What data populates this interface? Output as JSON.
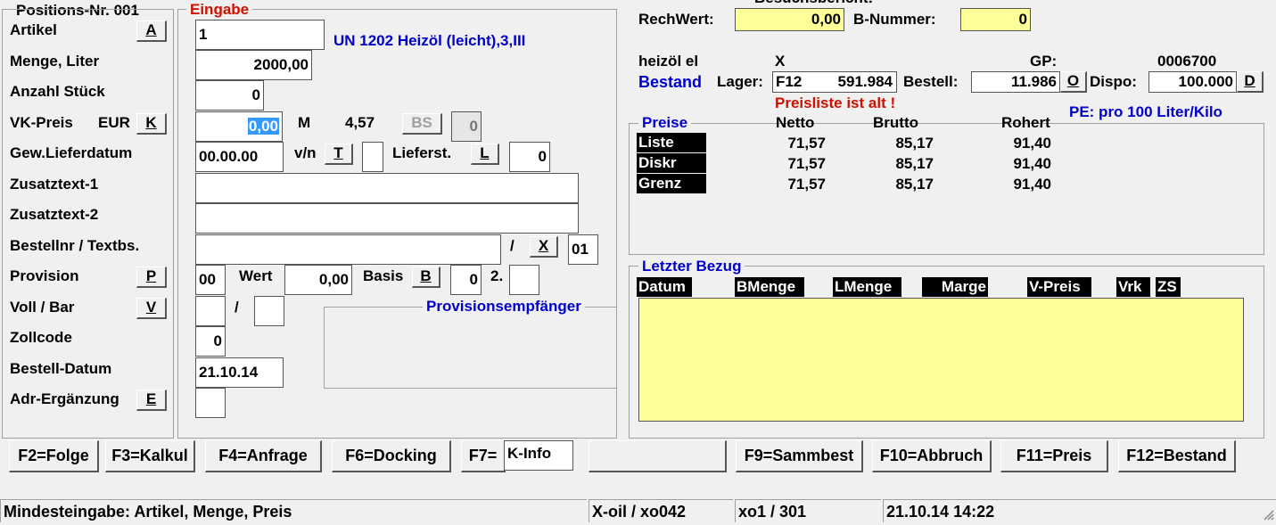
{
  "left": {
    "position_title": "Positions-Nr. 001",
    "rows": {
      "artikel": "Artikel",
      "menge": "Menge, Liter",
      "anzahl": "Anzahl Stück",
      "vkpreis": "VK-Preis",
      "gewlief": "Gew.Lieferdatum",
      "zusatz1": "Zusatztext-1",
      "zusatz2": "Zusatztext-2",
      "bestellnr": "Bestellnr / Textbs.",
      "provision": "Provision",
      "vollbar": "Voll / Bar",
      "zollcode": "Zollcode",
      "bestelldatum": "Bestell-Datum",
      "adrergaenzung": "Adr-Ergänzung"
    },
    "currency": "EUR",
    "buttons": {
      "artikel": "A",
      "vkpreis": "K",
      "provision": "P",
      "vollbar": "V",
      "adr": "E"
    }
  },
  "eingabe": {
    "title": "Eingabe",
    "artikel_value": "1",
    "artikel_desc": "UN 1202 Heizöl (leicht),3,III",
    "menge_value": "2000,00",
    "anzahl_value": "0",
    "vkpreis_value": "0,00",
    "m_label": "M",
    "m_value": "4,57",
    "bs_button": "BS",
    "bs_value": "0",
    "lieferdatum_value": "00.00.00",
    "vn_label": "v/n",
    "t_button": "T",
    "vn_value": "",
    "lieferst_label": "Lieferst.",
    "l_button": "L",
    "lieferst_value": "0",
    "zusatz1_value": "",
    "zusatz2_value": "",
    "bestellnr_value": "",
    "slash": "/",
    "x_button": "X",
    "bestellnr_suffix": "01",
    "provision_value": "00",
    "wert_label": "Wert",
    "wert_value": "0,00",
    "basis_label": "Basis",
    "b_button": "B",
    "basis_value": "0",
    "two_label": "2.",
    "two_value": "",
    "vollbar_value1": "",
    "vollbar_slash": "/",
    "vollbar_value2": "",
    "provisionsempfaenger": "Provisionsempfänger",
    "zollcode_value": "0",
    "bestelldatum_value": "21.10.14",
    "adr_value": ""
  },
  "right": {
    "besuchsbericht": "Besuchsbericht:",
    "rechwert_label": "RechWert:",
    "rechwert_value": "0,00",
    "bnummer_label": "B-Nummer:",
    "bnummer_value": "0",
    "product_name": "heizöl el",
    "x_mark": "X",
    "gp_label": "GP:",
    "gp_value": "0006700",
    "bestand_label": "Bestand",
    "lager_label": "Lager:",
    "lager_code": "F12",
    "lager_value": "591.984",
    "bestell_label": "Bestell:",
    "bestell_value": "11.986",
    "o_button": "O",
    "dispo_label": "Dispo:",
    "dispo_value": "100.000",
    "d_button": "D",
    "preisliste_alt": "Preisliste ist alt !",
    "pe_label": "PE:  pro 100 Liter/Kilo"
  },
  "preise": {
    "title": "Preise",
    "headers": [
      "Netto",
      "Brutto",
      "Rohert"
    ],
    "rows": [
      {
        "name": "Liste",
        "netto": "71,57",
        "brutto": "85,17",
        "rohert": "91,40"
      },
      {
        "name": "Diskr",
        "netto": "71,57",
        "brutto": "85,17",
        "rohert": "91,40"
      },
      {
        "name": "Grenz",
        "netto": "71,57",
        "brutto": "85,17",
        "rohert": "91,40"
      }
    ]
  },
  "bezug": {
    "title": "Letzter Bezug",
    "columns": [
      "Datum",
      "BMenge",
      "LMenge",
      "Marge",
      "V-Preis",
      "Vrk",
      "ZS"
    ]
  },
  "fkeys": {
    "f2": "F2=Folge",
    "f3": "F3=Kalkul",
    "f4": "F4=Anfrage",
    "f6": "F6=Docking",
    "f7": "F7=",
    "f7_value": "K-Info",
    "blank": "",
    "f9": "F9=Sammbest",
    "f10": "F10=Abbruch",
    "f11": "F11=Preis",
    "f12": "F12=Bestand"
  },
  "statusbar": {
    "hint": "Mindesteingabe: Artikel, Menge, Preis",
    "system": "X-oil / xo042",
    "user": "xo1 / 301",
    "datetime": "21.10.14 14:22"
  },
  "colors": {
    "accent_blue": "#0000cc",
    "warning_red": "#cc1100",
    "highlight_yellow": "#ffff99"
  }
}
